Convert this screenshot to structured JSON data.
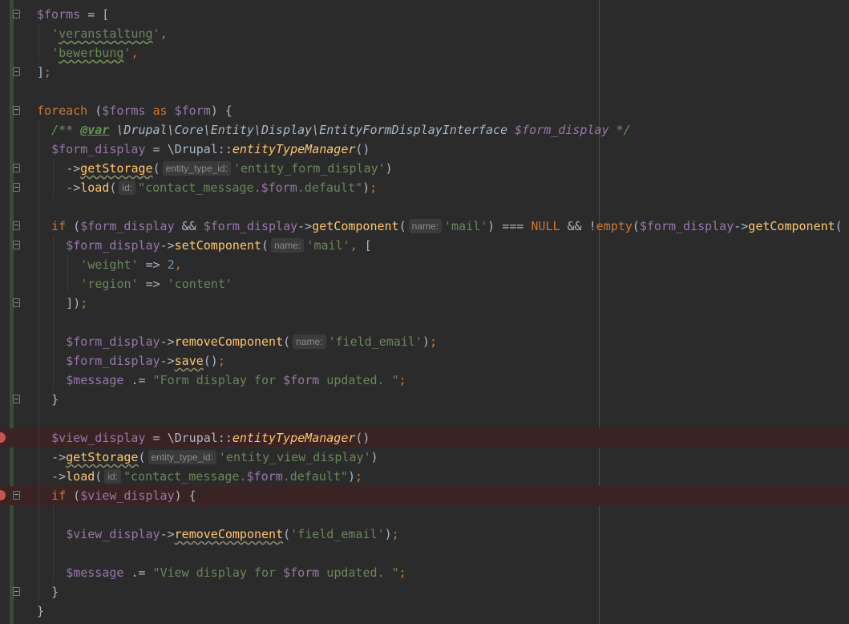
{
  "editor": {
    "lines": [
      {
        "id": "l1",
        "parts": [
          [
            "var",
            "$forms"
          ],
          [
            "plain",
            " = ["
          ]
        ]
      },
      {
        "id": "l2",
        "parts": [
          [
            "str",
            "'"
          ],
          [
            "strw",
            "veranstaltung"
          ],
          [
            "str",
            "'"
          ],
          [
            "kw",
            ","
          ]
        ]
      },
      {
        "id": "l3",
        "parts": [
          [
            "str",
            "'"
          ],
          [
            "strw",
            "bewerbung"
          ],
          [
            "str",
            "'"
          ],
          [
            "kw",
            ","
          ]
        ]
      },
      {
        "id": "l4",
        "parts": [
          [
            "plain",
            "]"
          ],
          [
            "kw",
            ";"
          ]
        ]
      },
      {
        "id": "l5",
        "parts": []
      },
      {
        "id": "l6",
        "parts": [
          [
            "kw",
            "foreach"
          ],
          [
            "plain",
            " ("
          ],
          [
            "var",
            "$forms"
          ],
          [
            "kw",
            " as "
          ],
          [
            "var",
            "$form"
          ],
          [
            "plain",
            ") {"
          ]
        ]
      },
      {
        "id": "l7",
        "parts": [
          [
            "cm",
            "/** "
          ],
          [
            "cmtag",
            "@var"
          ],
          [
            "cm",
            " "
          ],
          [
            "cmtype",
            "\\Drupal\\Core\\Entity\\Display\\EntityFormDisplayInterface"
          ],
          [
            "cm",
            " "
          ],
          [
            "cmvar",
            "$form_display"
          ],
          [
            "cm",
            " */"
          ]
        ]
      },
      {
        "id": "l8",
        "parts": [
          [
            "var",
            "$form_display"
          ],
          [
            "plain",
            " = \\Drupal::"
          ],
          [
            "fnit",
            "entityTypeManager"
          ],
          [
            "plain",
            "()"
          ]
        ]
      },
      {
        "id": "l9",
        "parts": [
          [
            "plain",
            "->"
          ],
          [
            "fnw",
            "getStorage"
          ],
          [
            "plain",
            "("
          ],
          [
            "hint",
            "entity_type_id:"
          ],
          [
            "str",
            "'entity_form_display'"
          ],
          [
            "plain",
            ")"
          ]
        ]
      },
      {
        "id": "l10",
        "parts": [
          [
            "plain",
            "->"
          ],
          [
            "fn",
            "load"
          ],
          [
            "plain",
            "("
          ],
          [
            "hint",
            "id:"
          ],
          [
            "str",
            "\"contact_message."
          ],
          [
            "var",
            "$form"
          ],
          [
            "str",
            ".default\""
          ],
          [
            "plain",
            ")"
          ],
          [
            "kw",
            ";"
          ]
        ]
      },
      {
        "id": "l11",
        "parts": []
      },
      {
        "id": "l12",
        "parts": [
          [
            "kw",
            "if"
          ],
          [
            "plain",
            " ("
          ],
          [
            "var",
            "$form_display"
          ],
          [
            "plain",
            " && "
          ],
          [
            "var",
            "$form_display"
          ],
          [
            "plain",
            "->"
          ],
          [
            "fn",
            "getComponent"
          ],
          [
            "plain",
            "("
          ],
          [
            "hint",
            "name:"
          ],
          [
            "str",
            "'mail'"
          ],
          [
            "plain",
            ") === "
          ],
          [
            "kw",
            "NULL"
          ],
          [
            "plain",
            " && !"
          ],
          [
            "kw",
            "empty"
          ],
          [
            "plain",
            "("
          ],
          [
            "var",
            "$form_display"
          ],
          [
            "plain",
            "->"
          ],
          [
            "fn",
            "getComponent"
          ],
          [
            "plain",
            "("
          ]
        ]
      },
      {
        "id": "l13",
        "parts": [
          [
            "var",
            "$form_display"
          ],
          [
            "plain",
            "->"
          ],
          [
            "fn",
            "setComponent"
          ],
          [
            "plain",
            "("
          ],
          [
            "hint",
            "name:"
          ],
          [
            "str",
            "'mail'"
          ],
          [
            "kw",
            ","
          ],
          [
            "plain",
            " ["
          ]
        ]
      },
      {
        "id": "l14",
        "parts": [
          [
            "str",
            "'weight'"
          ],
          [
            "plain",
            " => "
          ],
          [
            "num",
            "2"
          ],
          [
            "kw",
            ","
          ]
        ]
      },
      {
        "id": "l15",
        "parts": [
          [
            "str",
            "'region'"
          ],
          [
            "plain",
            " => "
          ],
          [
            "str",
            "'content'"
          ]
        ]
      },
      {
        "id": "l16",
        "parts": [
          [
            "plain",
            "])"
          ],
          [
            "kw",
            ";"
          ]
        ]
      },
      {
        "id": "l17",
        "parts": []
      },
      {
        "id": "l18",
        "parts": [
          [
            "var",
            "$form_display"
          ],
          [
            "plain",
            "->"
          ],
          [
            "fn",
            "removeComponent"
          ],
          [
            "plain",
            "("
          ],
          [
            "hint",
            "name:"
          ],
          [
            "str",
            "'field_email'"
          ],
          [
            "plain",
            ")"
          ],
          [
            "kw",
            ";"
          ]
        ]
      },
      {
        "id": "l19",
        "parts": [
          [
            "var",
            "$form_display"
          ],
          [
            "plain",
            "->"
          ],
          [
            "fnw",
            "save"
          ],
          [
            "plain",
            "()"
          ],
          [
            "kw",
            ";"
          ]
        ]
      },
      {
        "id": "l20",
        "parts": [
          [
            "var",
            "$message"
          ],
          [
            "plain",
            " .= "
          ],
          [
            "str",
            "\"Form display for "
          ],
          [
            "var",
            "$form"
          ],
          [
            "str",
            " updated. \""
          ],
          [
            "kw",
            ";"
          ]
        ]
      },
      {
        "id": "l21",
        "parts": [
          [
            "plain",
            "}"
          ]
        ]
      },
      {
        "id": "l22",
        "parts": []
      },
      {
        "id": "l23",
        "parts": [
          [
            "var",
            "$view_display"
          ],
          [
            "plain",
            " = \\Drupal::"
          ],
          [
            "fnit",
            "entityTypeManager"
          ],
          [
            "plain",
            "()"
          ]
        ]
      },
      {
        "id": "l24",
        "parts": [
          [
            "plain",
            "->"
          ],
          [
            "fnw",
            "getStorage"
          ],
          [
            "plain",
            "("
          ],
          [
            "hint",
            "entity_type_id:"
          ],
          [
            "str",
            "'entity_view_display'"
          ],
          [
            "plain",
            ")"
          ]
        ]
      },
      {
        "id": "l25",
        "parts": [
          [
            "plain",
            "->"
          ],
          [
            "fn",
            "load"
          ],
          [
            "plain",
            "("
          ],
          [
            "hint",
            "id:"
          ],
          [
            "str",
            "\"contact_message."
          ],
          [
            "var",
            "$form"
          ],
          [
            "str",
            ".default\""
          ],
          [
            "plain",
            ")"
          ],
          [
            "kw",
            ";"
          ]
        ]
      },
      {
        "id": "l26",
        "parts": [
          [
            "kw",
            "if"
          ],
          [
            "plain",
            " ("
          ],
          [
            "var",
            "$view_display"
          ],
          [
            "plain",
            ") {"
          ]
        ]
      },
      {
        "id": "l27",
        "parts": []
      },
      {
        "id": "l28",
        "parts": [
          [
            "var",
            "$view_display"
          ],
          [
            "plain",
            "->"
          ],
          [
            "fnw",
            "removeComponent"
          ],
          [
            "plain",
            "("
          ],
          [
            "str",
            "'field_email'"
          ],
          [
            "plain",
            ")"
          ],
          [
            "kw",
            ";"
          ]
        ]
      },
      {
        "id": "l29",
        "parts": []
      },
      {
        "id": "l30",
        "parts": [
          [
            "var",
            "$message"
          ],
          [
            "plain",
            " .= "
          ],
          [
            "str",
            "\"View display for "
          ],
          [
            "var",
            "$form"
          ],
          [
            "str",
            " updated. \""
          ],
          [
            "kw",
            ";"
          ]
        ]
      },
      {
        "id": "l31",
        "parts": [
          [
            "plain",
            "}"
          ]
        ]
      },
      {
        "id": "l32",
        "parts": [
          [
            "plain",
            "}"
          ]
        ]
      }
    ],
    "breakpoint_lines": [
      "l23",
      "l26"
    ],
    "colors": {
      "background": "#2b2b2b",
      "variable": "#9876aa",
      "string": "#6a8759",
      "keyword": "#cc7832",
      "function": "#ffc66d",
      "number": "#6897bb",
      "comment": "#629755",
      "breakpoint": "#c75450",
      "breakpoint_line": "#3a2323"
    },
    "icons": [
      "fold-open-icon",
      "fold-close-icon",
      "breakpoint-icon"
    ]
  }
}
